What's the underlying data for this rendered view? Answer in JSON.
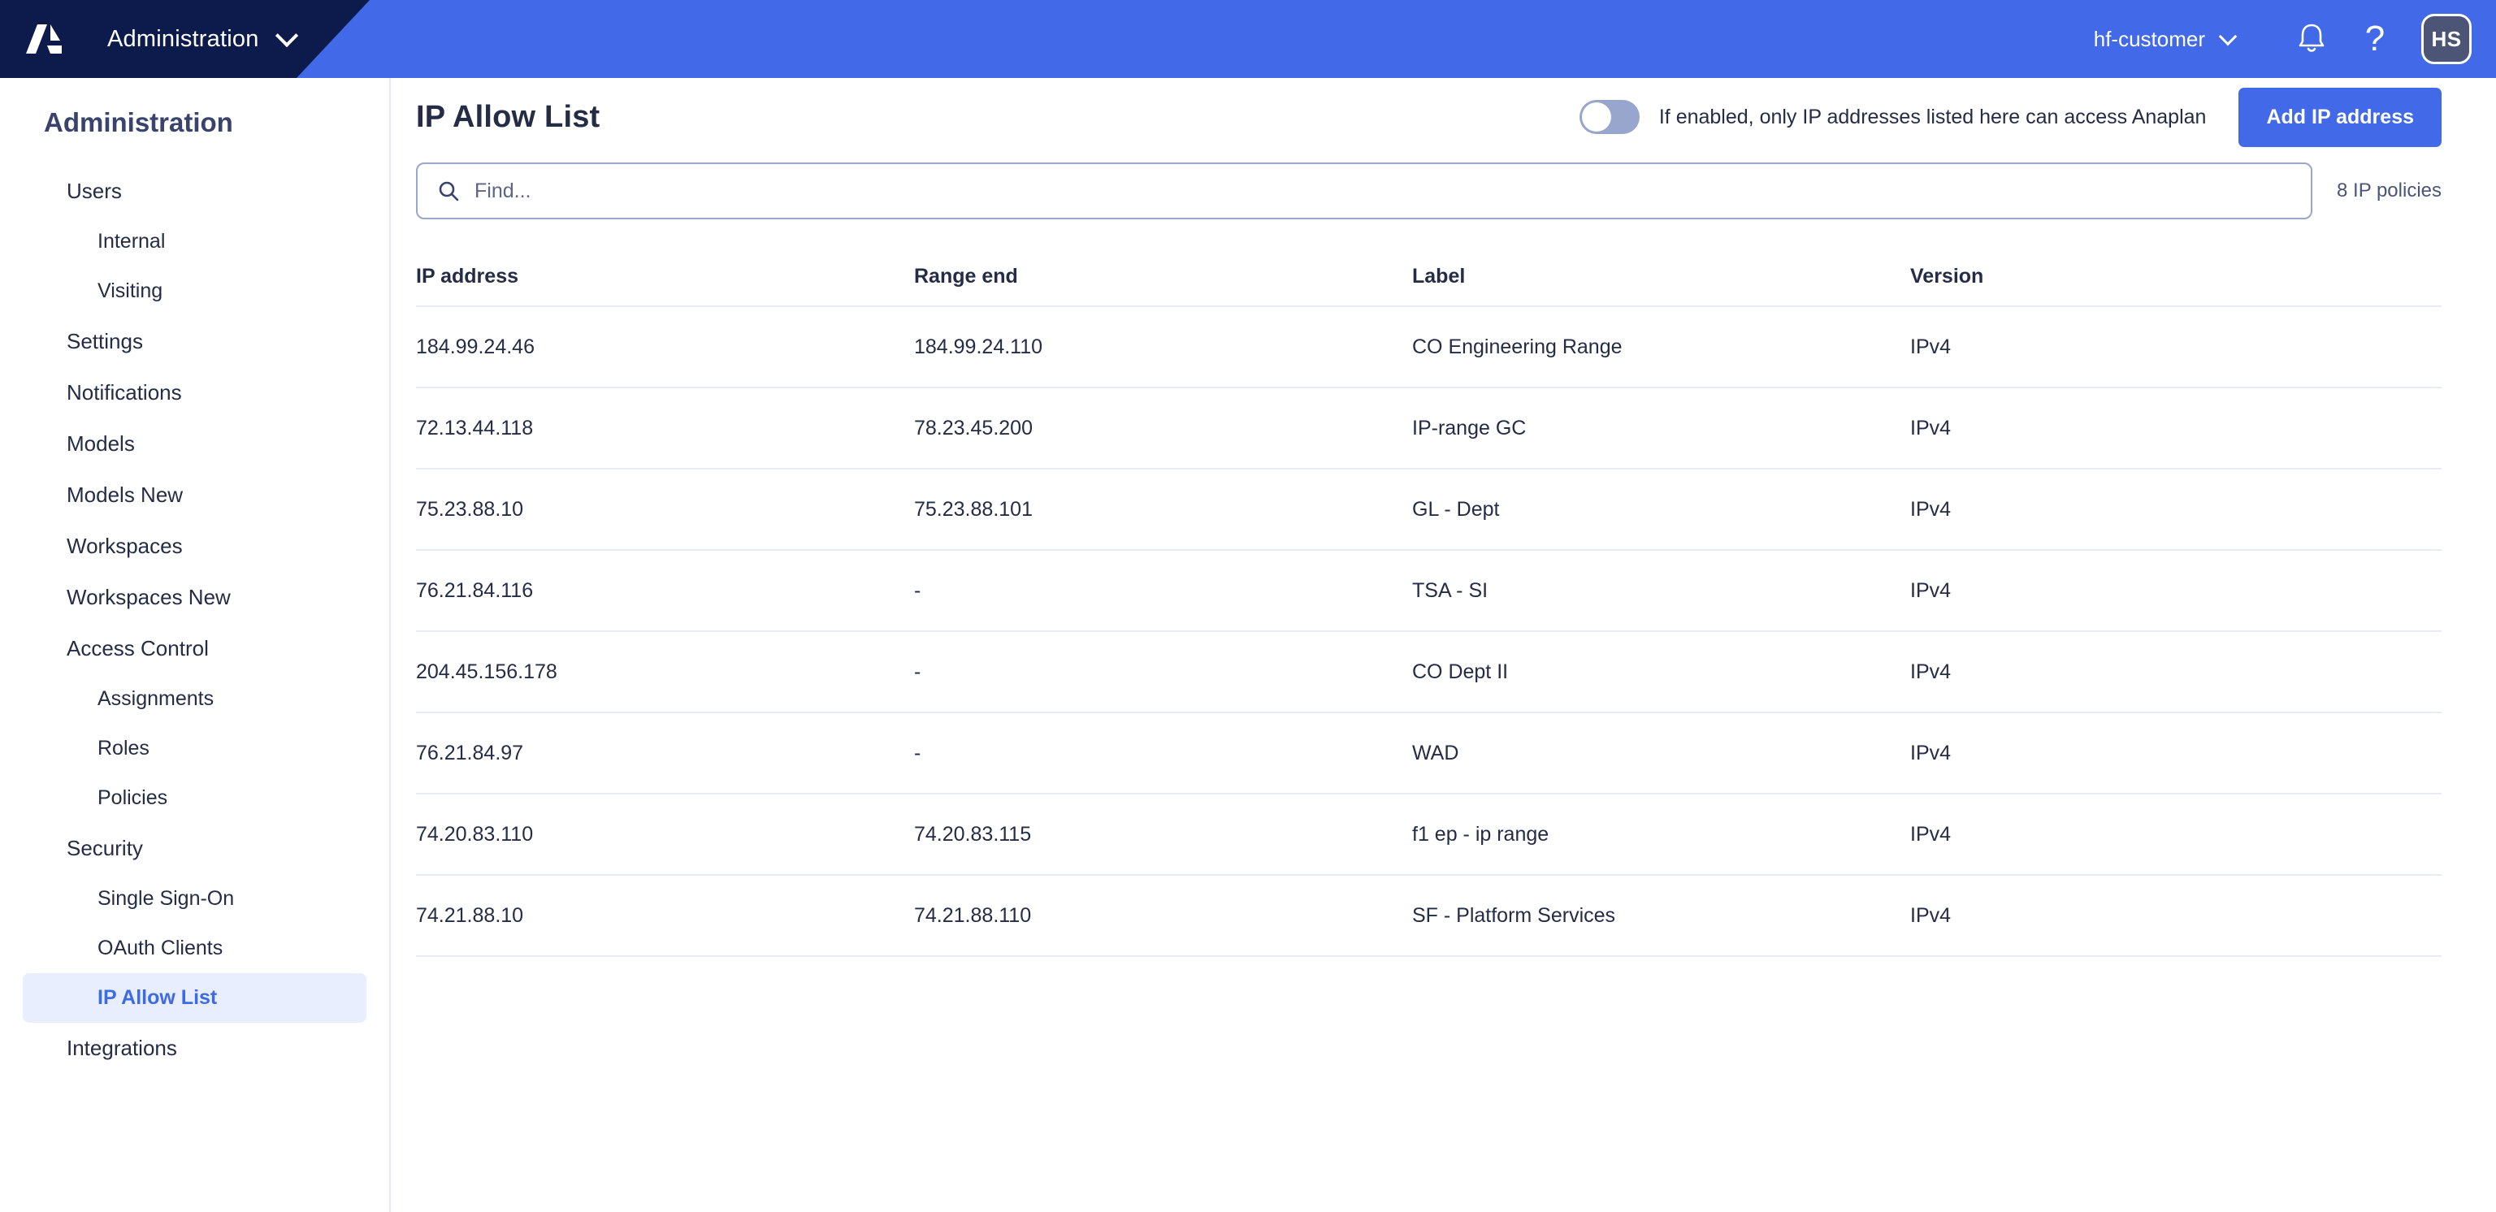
{
  "topbar": {
    "logo_icon": "anaplan-logo",
    "app_menu_label": "Administration",
    "app_menu_chevron_icon": "chevron-down-icon",
    "tenant_label": "hf-customer",
    "tenant_chevron_icon": "chevron-down-icon",
    "notifications_icon": "bell-icon",
    "help_icon": "question-mark-icon",
    "help_glyph": "?",
    "avatar_initials": "HS",
    "navy_color": "#0D1B4C",
    "accent_color": "#4169E8",
    "avatar_color": "#4C5575"
  },
  "sidebar": {
    "title": "Administration",
    "items": [
      {
        "label": "Users",
        "level": 0,
        "active": false
      },
      {
        "label": "Internal",
        "level": 1,
        "active": false
      },
      {
        "label": "Visiting",
        "level": 1,
        "active": false
      },
      {
        "label": "Settings",
        "level": 0,
        "active": false
      },
      {
        "label": "Notifications",
        "level": 0,
        "active": false
      },
      {
        "label": "Models",
        "level": 0,
        "active": false
      },
      {
        "label": "Models New",
        "level": 0,
        "active": false
      },
      {
        "label": "Workspaces",
        "level": 0,
        "active": false
      },
      {
        "label": "Workspaces New",
        "level": 0,
        "active": false
      },
      {
        "label": "Access Control",
        "level": 0,
        "active": false
      },
      {
        "label": "Assignments",
        "level": 1,
        "active": false
      },
      {
        "label": "Roles",
        "level": 1,
        "active": false
      },
      {
        "label": "Policies",
        "level": 1,
        "active": false
      },
      {
        "label": "Security",
        "level": 0,
        "active": false
      },
      {
        "label": "Single Sign-On",
        "level": 1,
        "active": false
      },
      {
        "label": "OAuth Clients",
        "level": 1,
        "active": false
      },
      {
        "label": "IP Allow List",
        "level": 1,
        "active": true
      },
      {
        "label": "Integrations",
        "level": 0,
        "active": false
      }
    ],
    "active_bg_color": "#E8EEFE",
    "active_text_color": "#3D6BE5"
  },
  "page": {
    "title": "IP Allow List",
    "toggle": {
      "state": "off",
      "description": "If enabled, only IP addresses listed here can access Anaplan",
      "track_color": "#98A6CD"
    },
    "add_button_label": "Add IP address"
  },
  "search": {
    "icon": "search-icon",
    "placeholder": "Find...",
    "value": ""
  },
  "policy_count_label": "8 IP policies",
  "table": {
    "columns": [
      "IP address",
      "Range end",
      "Label",
      "Version"
    ],
    "rows": [
      {
        "ip": "184.99.24.46",
        "range_end": "184.99.24.110",
        "label": "CO Engineering Range",
        "version": "IPv4"
      },
      {
        "ip": "72.13.44.118",
        "range_end": "78.23.45.200",
        "label": "IP-range GC",
        "version": "IPv4"
      },
      {
        "ip": "75.23.88.10",
        "range_end": "75.23.88.101",
        "label": "GL - Dept",
        "version": "IPv4"
      },
      {
        "ip": "76.21.84.116",
        "range_end": "-",
        "label": "TSA - SI",
        "version": "IPv4"
      },
      {
        "ip": "204.45.156.178",
        "range_end": "-",
        "label": "CO Dept II",
        "version": "IPv4"
      },
      {
        "ip": "76.21.84.97",
        "range_end": "-",
        "label": "WAD",
        "version": "IPv4"
      },
      {
        "ip": "74.20.83.110",
        "range_end": "74.20.83.115",
        "label": "f1 ep - ip range",
        "version": "IPv4"
      },
      {
        "ip": "74.21.88.10",
        "range_end": "74.21.88.110",
        "label": "SF - Platform Services",
        "version": "IPv4"
      }
    ]
  }
}
